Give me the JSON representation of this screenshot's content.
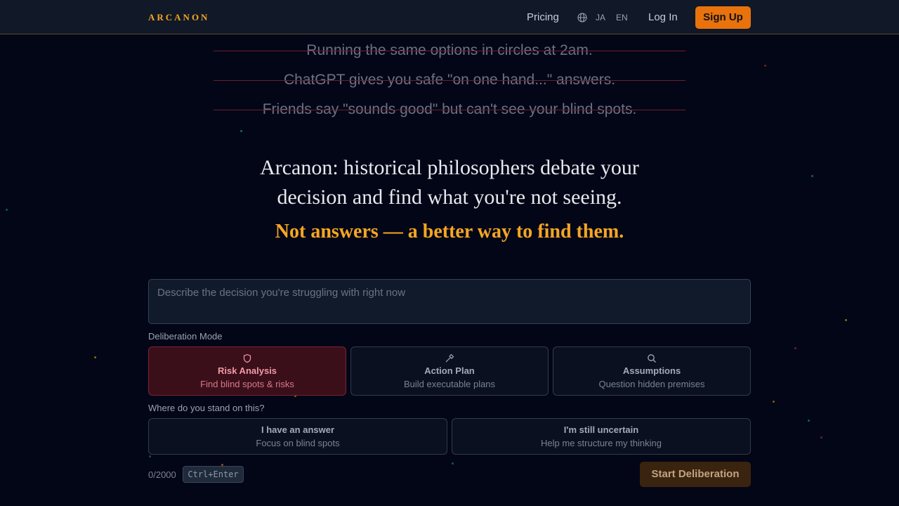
{
  "nav": {
    "brand": "ARCANON",
    "pricing": "Pricing",
    "lang_ja": "JA",
    "lang_en": "EN",
    "login": "Log In",
    "signup": "Sign Up"
  },
  "struck_lines": [
    "Running the same options in circles at 2am.",
    "ChatGPT gives you safe \"on one hand...\" answers.",
    "Friends say \"sounds good\" but can't see your blind spots."
  ],
  "hero": {
    "headline": "Arcanon: historical philosophers debate your decision and find what you're not seeing.",
    "tagline": "Not answers — a better way to find them."
  },
  "input": {
    "placeholder": "Describe the decision you're struggling with right now",
    "value": ""
  },
  "deliberation": {
    "label": "Deliberation Mode",
    "modes": [
      {
        "icon": "shield-icon",
        "title": "Risk Analysis",
        "subtitle": "Find blind spots & risks",
        "selected": true
      },
      {
        "icon": "hammer-icon",
        "title": "Action Plan",
        "subtitle": "Build executable plans",
        "selected": false
      },
      {
        "icon": "search-icon",
        "title": "Assumptions",
        "subtitle": "Question hidden premises",
        "selected": false
      }
    ]
  },
  "stance": {
    "label": "Where do you stand on this?",
    "options": [
      {
        "title": "I have an answer",
        "subtitle": "Focus on blind spots"
      },
      {
        "title": "I'm still uncertain",
        "subtitle": "Help me structure my thinking"
      }
    ]
  },
  "footer": {
    "char_count": "0/2000",
    "shortcut": "Ctrl+Enter",
    "start": "Start Deliberation"
  },
  "colors": {
    "accent": "#f5a623",
    "signup_bg": "#e8720c",
    "selected_card_bg": "#3a0f1a",
    "background": "#030617"
  }
}
